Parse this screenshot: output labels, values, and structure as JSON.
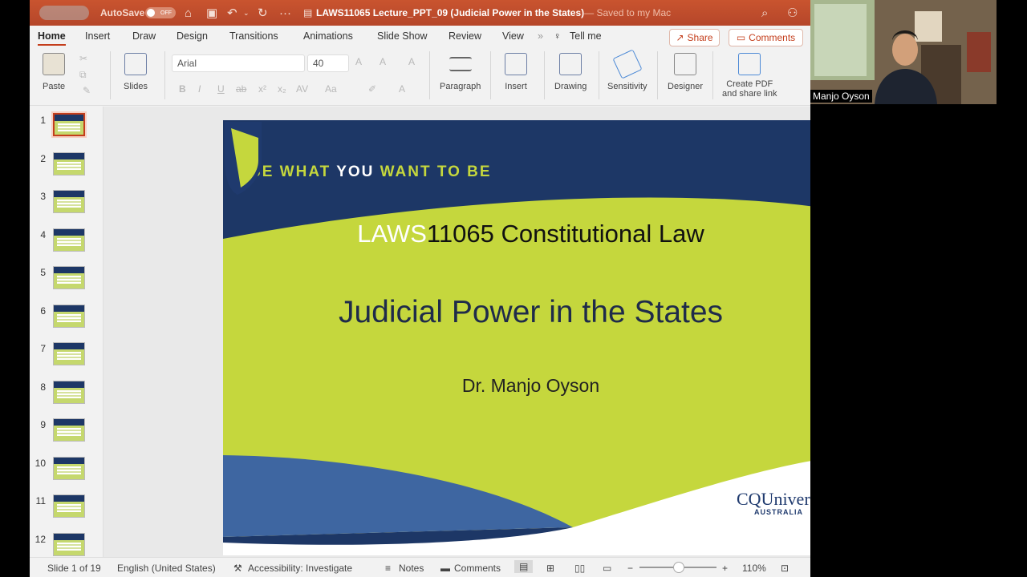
{
  "titlebar": {
    "autosave": "AutoSave",
    "autosave_state": "OFF",
    "doc_title": "LAWS11065 Lecture_PPT_09 (Judicial Power in the States)",
    "saved_status": " — Saved to my Mac"
  },
  "tabs": [
    "Home",
    "Insert",
    "Draw",
    "Design",
    "Transitions",
    "Animations",
    "Slide Show",
    "Review",
    "View"
  ],
  "tell_me": "Tell me",
  "share": "Share",
  "comments_btn": "Comments",
  "ribbon": {
    "paste": "Paste",
    "slides": "Slides",
    "font_name": "Arial",
    "font_size": "40",
    "paragraph": "Paragraph",
    "insert": "Insert",
    "drawing": "Drawing",
    "sensitivity": "Sensitivity",
    "designer": "Designer",
    "create_pdf_1": "Create PDF",
    "create_pdf_2": "and share link"
  },
  "thumbnails": [
    "1",
    "2",
    "3",
    "4",
    "5",
    "6",
    "7",
    "8",
    "9",
    "10",
    "11",
    "12"
  ],
  "slide": {
    "tagline_1": "BE WHAT ",
    "tagline_2": "YOU",
    "tagline_3": " WANT TO BE",
    "course_code": "LAWS",
    "course_rest": "11065 Constitutional Law",
    "title": "Judicial Power in the States",
    "author": "Dr. Manjo Oyson",
    "logo_main": "CQUniversity",
    "logo_sub": "AUSTRALIA"
  },
  "status": {
    "slide_of": "Slide 1 of 19",
    "language": "English (United States)",
    "accessibility": "Accessibility: Investigate",
    "notes": "Notes",
    "comments": "Comments",
    "zoom": "110%"
  },
  "video": {
    "name": "Manjo Oyson"
  },
  "colors": {
    "accent": "#c43e1c",
    "slide_navy": "#1d3766",
    "slide_lime": "#c5d73d"
  }
}
